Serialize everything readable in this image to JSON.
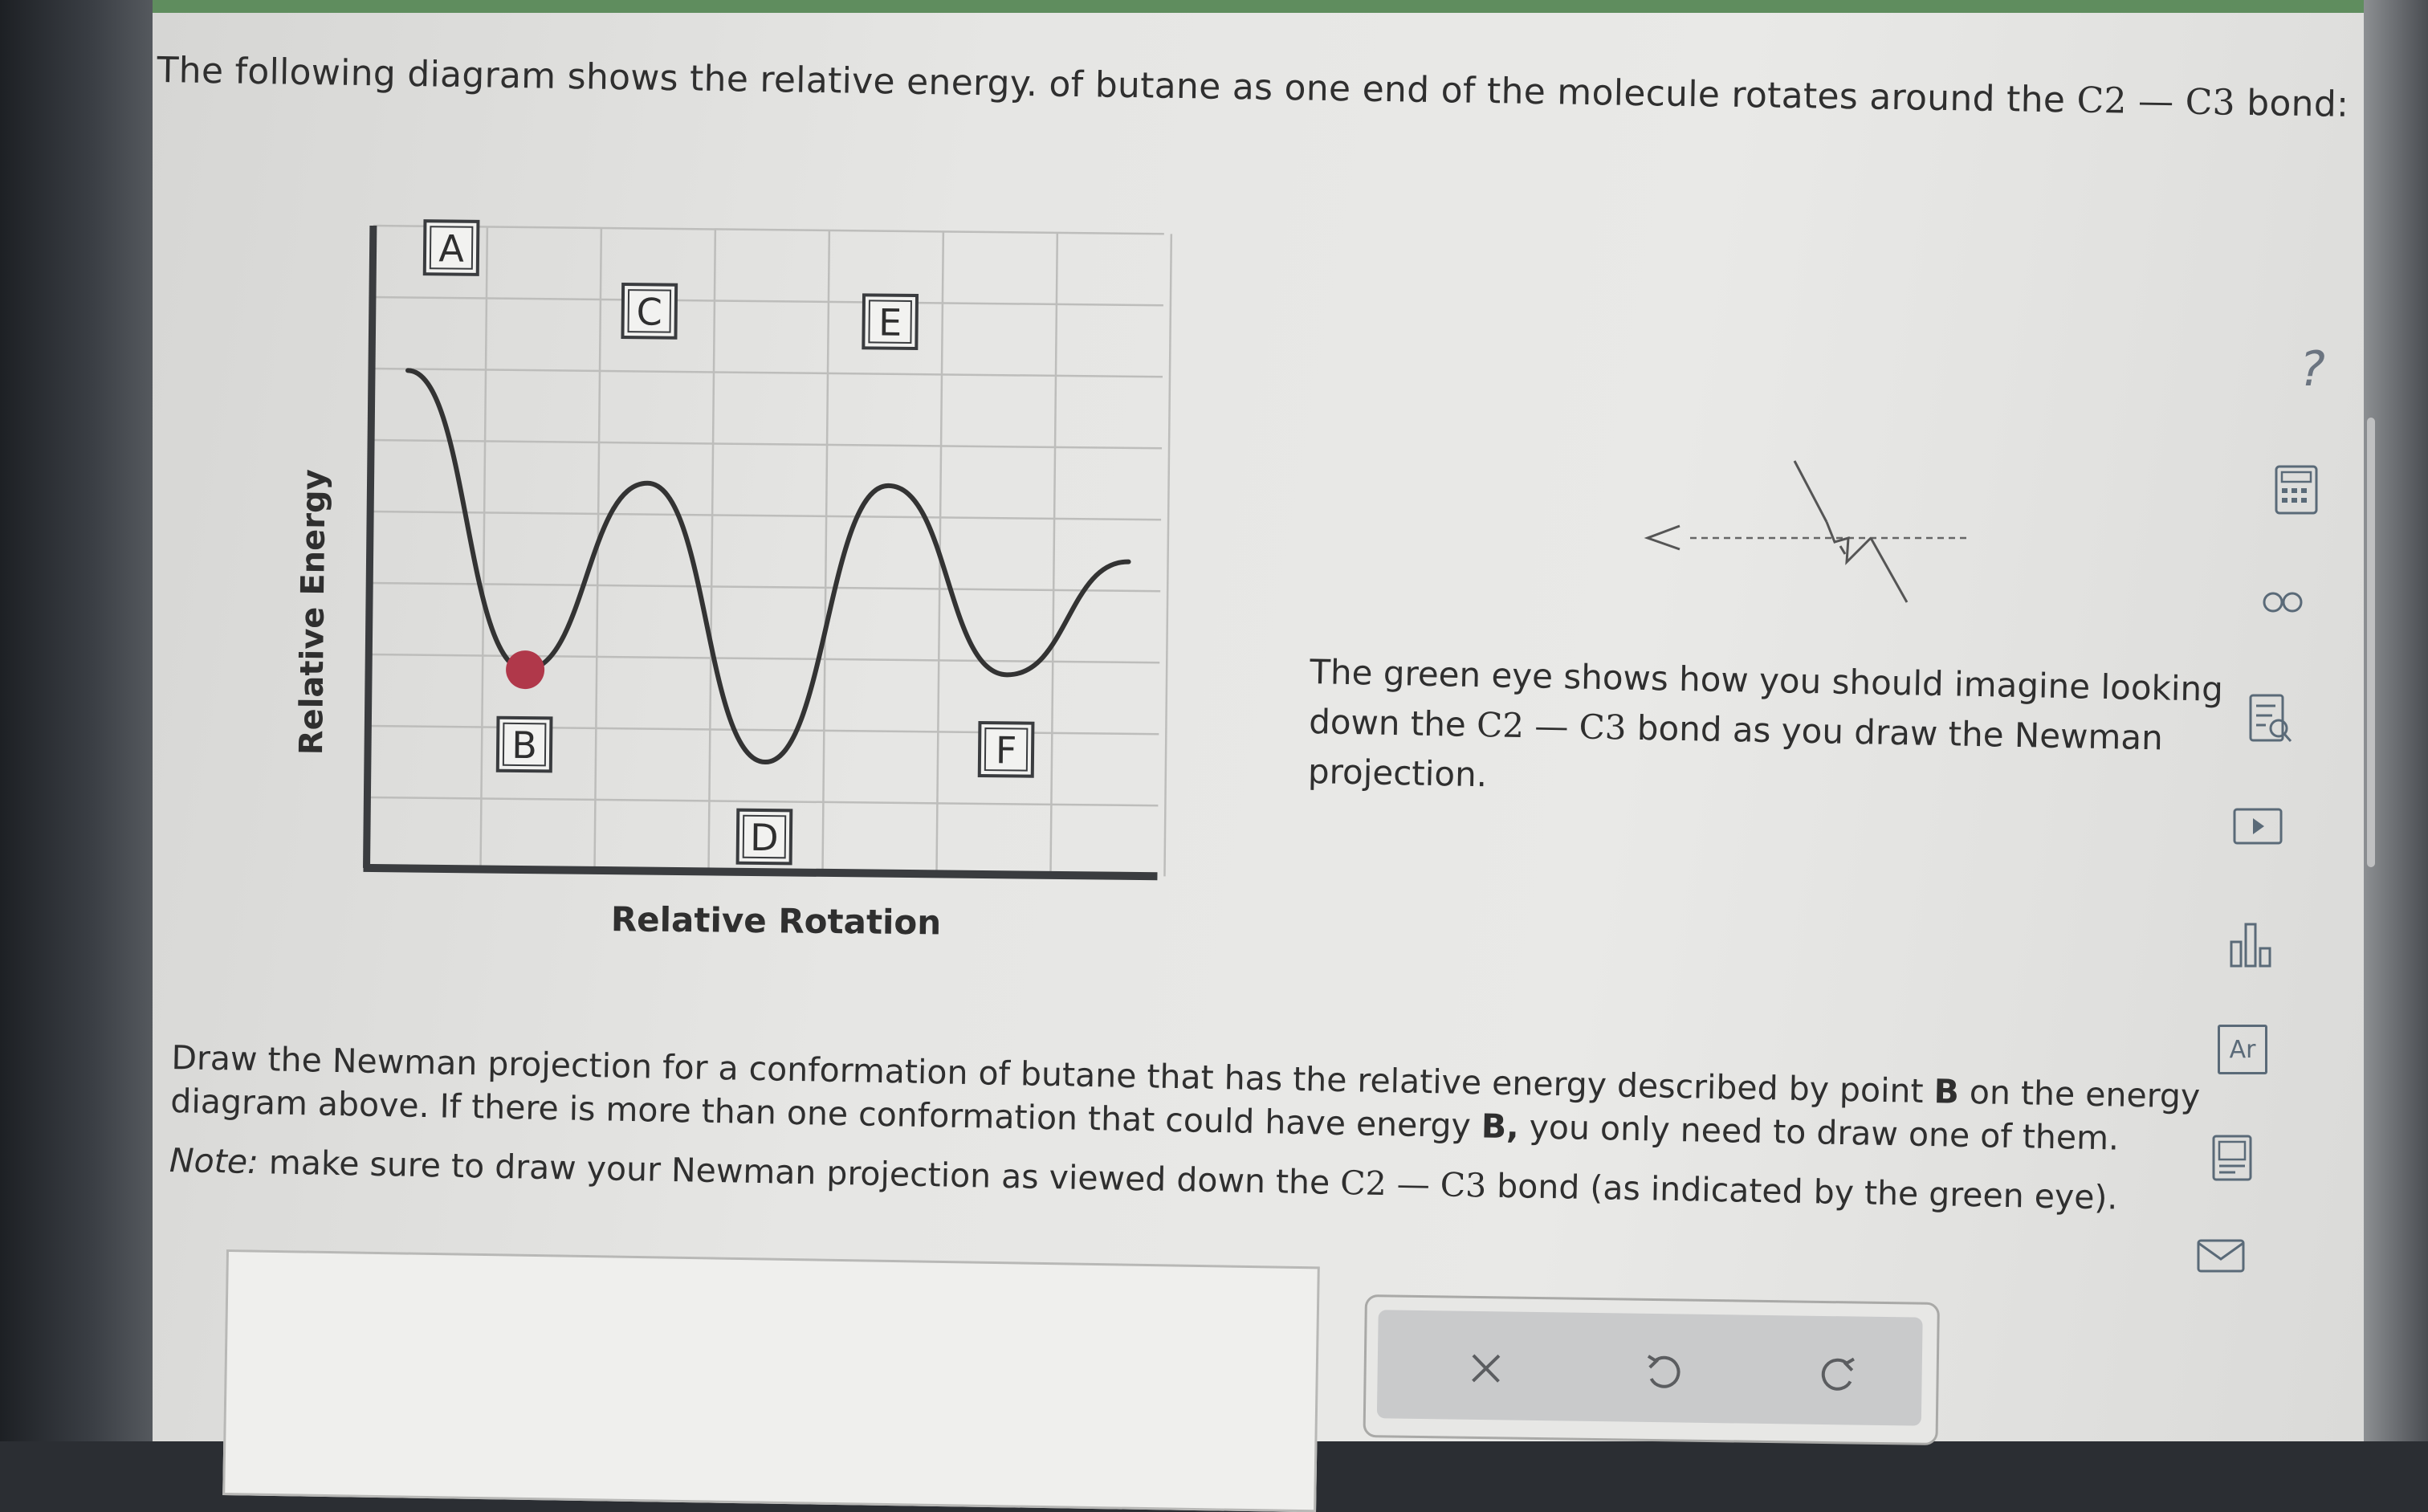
{
  "question": {
    "text_before": "The following diagram shows the relative energy. of butane as one end of the molecule rotates around the ",
    "bond": "C2 — C3",
    "text_after": " bond:"
  },
  "chart_data": {
    "type": "line",
    "xlabel": "Relative Rotation",
    "ylabel": "Relative Energy",
    "x": [
      0,
      1,
      2,
      3,
      4,
      5,
      6
    ],
    "y": [
      8.5,
      1.2,
      5.8,
      -1.0,
      5.8,
      1.2,
      4.0
    ],
    "ylim": [
      -3.5,
      12
    ],
    "grid": true,
    "points": [
      {
        "label": "A",
        "x": 0.35,
        "y": 10.2
      },
      {
        "label": "B",
        "x": 1.0,
        "y": 1.2,
        "highlighted": true
      },
      {
        "label": "C",
        "x": 2.0,
        "y": 8.7
      },
      {
        "label": "D",
        "x": 3.0,
        "y": -1.0
      },
      {
        "label": "E",
        "x": 4.0,
        "y": 8.5
      },
      {
        "label": "F",
        "x": 5.0,
        "y": 1.2
      }
    ]
  },
  "eye_note": {
    "text_before": "The green eye shows how you should imagine looking down the ",
    "bond": "C2 — C3",
    "text_after": " bond as you draw the Newman projection."
  },
  "instructions": {
    "part1": "Draw the Newman projection for a conformation of butane that has the relative energy described by point ",
    "point": "B",
    "part2": " on the energy diagram above. If there is more than one conformation that could have energy ",
    "point2": "B,",
    "part3": " you only need to draw one of them.",
    "note_label": "Note:",
    "note_text": " make sure to draw your Newman projection as viewed down the ",
    "note_bond": "C2 — C3",
    "note_after": " bond (as indicated by the green eye)."
  },
  "toolbar": {
    "clear_icon": "x-icon",
    "undo_icon": "undo-icon",
    "redo_icon": "redo-icon"
  },
  "side_tools": {
    "help_label": "?",
    "periodic_label": "Ar"
  },
  "colors": {
    "top_bar": "#5f8d5e",
    "point_marker": "#b0384a",
    "curve": "#333333"
  }
}
